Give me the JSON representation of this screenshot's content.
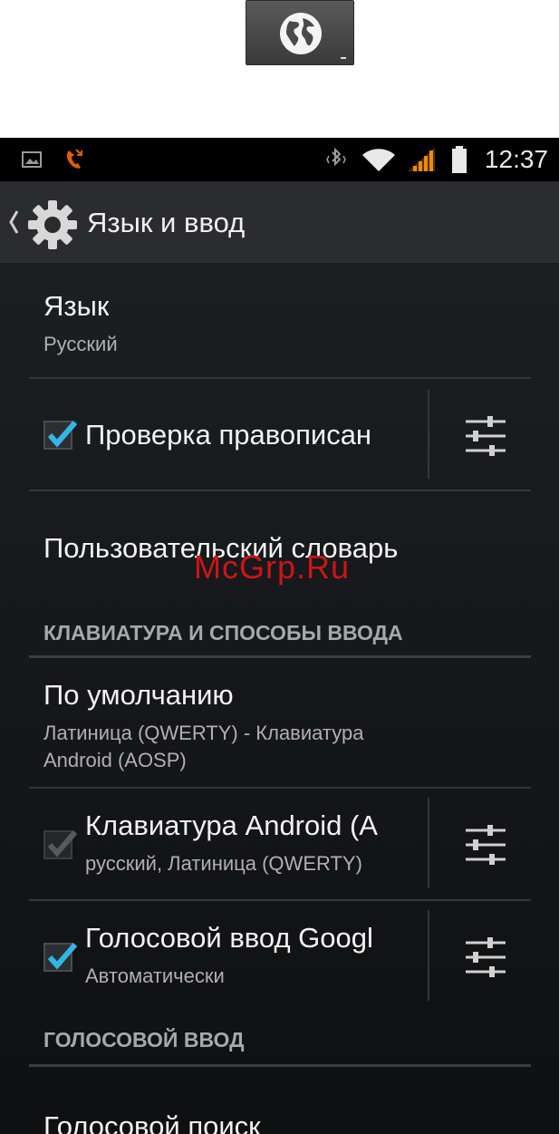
{
  "top_icon": {
    "name": "globe-icon"
  },
  "status_bar": {
    "time": "12:37",
    "icons": [
      "gallery-notification-icon",
      "missed-call-icon",
      "bluetooth-icon",
      "wifi-icon",
      "signal-icon",
      "battery-icon"
    ],
    "signal_color": "#f08a00",
    "missed_call_color": "#e06000"
  },
  "action_bar": {
    "title": "Язык и ввод",
    "icon": "gear-icon"
  },
  "items": {
    "language": {
      "title": "Язык",
      "summary": "Русский"
    },
    "spellcheck": {
      "title": "Проверка правописан",
      "checked": true
    },
    "user_dictionary": {
      "title": "Пользовательский словарь"
    },
    "section_keyboard": "КЛАВИАТУРА И СПОСОБЫ ВВОДА",
    "default": {
      "title": "По умолчанию",
      "summary_line1": "Латиница (QWERTY) - Клавиатура",
      "summary_line2": "Android (AOSP)"
    },
    "android_keyboard": {
      "title": "Клавиатура Android (A",
      "summary": "русский, Латиница (QWERTY)",
      "checked": true,
      "disabled": true
    },
    "google_voice": {
      "title": "Голосовой ввод Googl",
      "summary": "Автоматически",
      "checked": true
    },
    "section_voice": "ГОЛОСОВОЙ ВВОД",
    "voice_search": {
      "title": "Голосовой поиск"
    }
  },
  "watermark": "McGrp.Ru",
  "accent_color": "#33b5e5"
}
